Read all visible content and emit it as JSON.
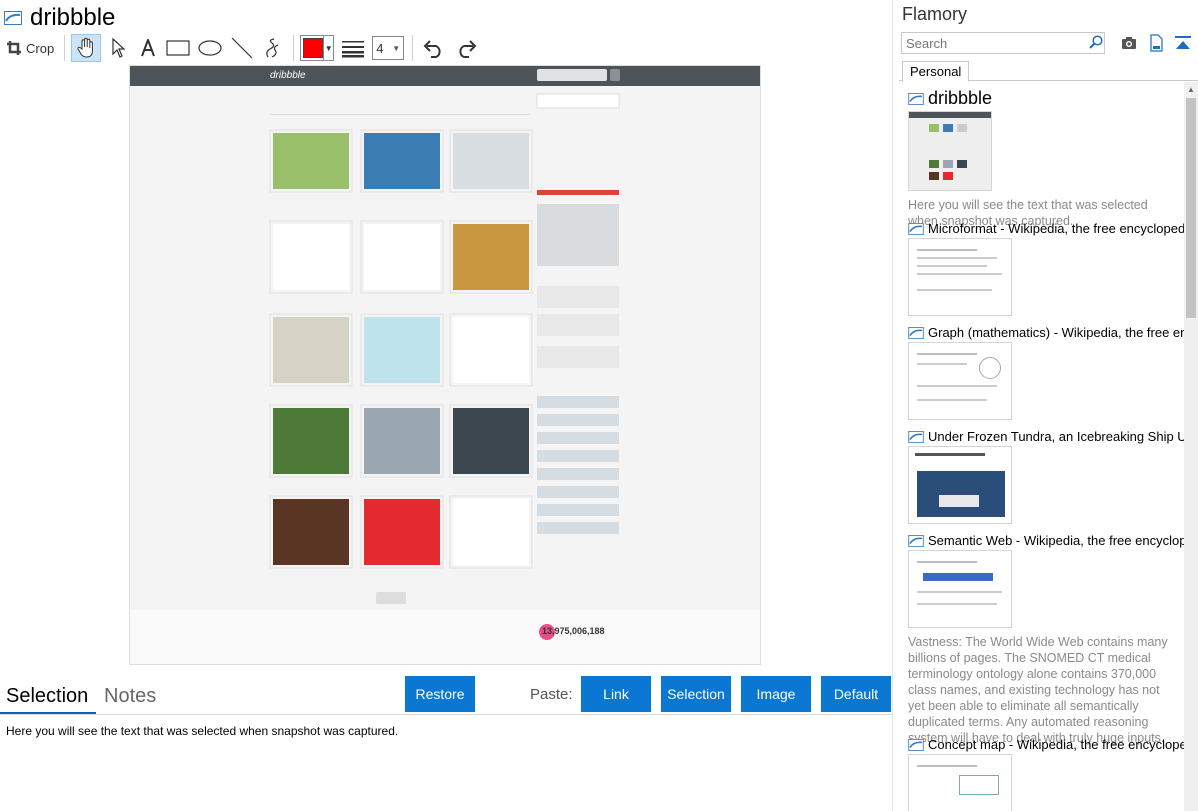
{
  "window": {
    "title": "dribbble"
  },
  "toolbar": {
    "crop_label": "Crop",
    "line_width": "4",
    "stroke_color": "#ff0000"
  },
  "snapshot": {
    "logo_text": "dribbble",
    "total_shots": "13,975,006,188"
  },
  "bottom": {
    "tab_selection": "Selection",
    "tab_notes": "Notes",
    "restore_label": "Restore",
    "paste_label": "Paste:",
    "link_label": "Link",
    "selection_label": "Selection",
    "image_label": "Image",
    "default_label": "Default",
    "selection_text": "Here you will see the text that was selected when snapshot was captured."
  },
  "sidebar": {
    "app_title": "Flamory",
    "search_placeholder": "Search",
    "tab_personal": "Personal",
    "items": [
      {
        "title": "dribbble",
        "note": "Here you will see the text that was selected when snapshot was captured."
      },
      {
        "title": "Microformat - Wikipedia, the free encyclopedia"
      },
      {
        "title": "Graph (mathematics) - Wikipedia, the free ency"
      },
      {
        "title": "Under Frozen Tundra, an Icebreaking Ship Unco"
      },
      {
        "title": "Semantic Web - Wikipedia, the free encycloped",
        "note": "Vastness: The World Wide Web contains many billions of pages. The SNOMED CT medical terminology ontology alone contains 370,000 class names, and existing technology has not yet been able to eliminate all semantically duplicated terms. Any automated reasoning system will have to deal with truly huge inputs."
      },
      {
        "title": "Concept map - Wikipedia, the free encyclopedia"
      }
    ]
  },
  "colors": {
    "accent": "#0a78d2",
    "tab_underline": "#0067c0",
    "hand_active_bg": "#cce4f7"
  }
}
